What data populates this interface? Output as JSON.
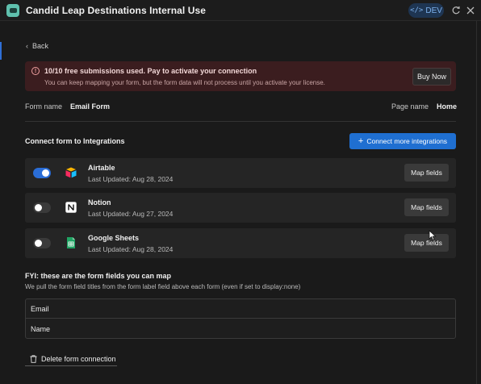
{
  "window": {
    "title": "Candid Leap Destinations Internal Use",
    "env_badge": "DEV",
    "env_badge_icon": "</>",
    "icons": [
      "app-icon",
      "code-icon",
      "refresh-icon",
      "close-icon"
    ]
  },
  "nav": {
    "back_label": "Back"
  },
  "alert": {
    "title": "10/10 free submissions used. Pay to activate your connection",
    "body": "You can keep mapping your form, but the form data will not process until you activate your license.",
    "button": "Buy Now",
    "icon": "warning-icon"
  },
  "form_meta": {
    "form_label": "Form name",
    "form_value": "Email Form",
    "page_label": "Page name",
    "page_value": "Home"
  },
  "integrations_section": {
    "title": "Connect form to Integrations",
    "connect_button": "Connect more integrations",
    "items": [
      {
        "name": "Airtable",
        "updated": "Last Updated: Aug 28, 2024",
        "enabled": true,
        "button": "Map fields",
        "icon": "airtable-icon"
      },
      {
        "name": "Notion",
        "updated": "Last Updated: Aug 27, 2024",
        "enabled": false,
        "button": "Map fields",
        "icon": "notion-icon"
      },
      {
        "name": "Google Sheets",
        "updated": "Last Updated: Aug 28, 2024",
        "enabled": false,
        "button": "Map fields",
        "icon": "google-sheets-icon"
      }
    ]
  },
  "fyi": {
    "title": "FYI: these are the form fields you can map",
    "description": "We pull the form field titles from the form label field above each form (even if set to display:none)",
    "fields": [
      "Email",
      "Name"
    ]
  },
  "footer": {
    "delete_label": "Delete form connection"
  },
  "colors": {
    "background": "#1a1a1a",
    "accent": "#1f6fd1",
    "alert_bg": "#3b1d1f",
    "row_bg": "#252525",
    "toggle_on": "#2a6dd6"
  }
}
